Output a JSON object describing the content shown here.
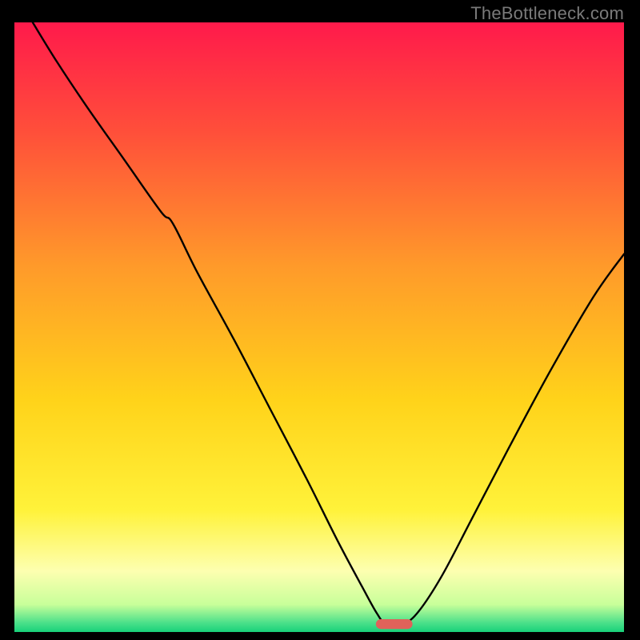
{
  "watermark": "TheBottleneck.com",
  "chart_data": {
    "type": "line",
    "title": "",
    "xlabel": "",
    "ylabel": "",
    "xlim": [
      0,
      100
    ],
    "ylim": [
      0,
      100
    ],
    "grid": false,
    "legend": false,
    "background_gradient": {
      "stops": [
        {
          "offset": 0.0,
          "color": "#ff1a4b"
        },
        {
          "offset": 0.18,
          "color": "#ff4f3a"
        },
        {
          "offset": 0.4,
          "color": "#ff9a2a"
        },
        {
          "offset": 0.62,
          "color": "#ffd31a"
        },
        {
          "offset": 0.8,
          "color": "#fff23a"
        },
        {
          "offset": 0.9,
          "color": "#fdffb0"
        },
        {
          "offset": 0.955,
          "color": "#c8ff9a"
        },
        {
          "offset": 0.985,
          "color": "#4be08a"
        },
        {
          "offset": 1.0,
          "color": "#18d17a"
        }
      ]
    },
    "series": [
      {
        "name": "bottleneck-curve",
        "stroke": "#000000",
        "x": [
          3.0,
          7.0,
          12.0,
          18.0,
          24.0,
          26.0,
          30.0,
          36.0,
          42.0,
          48.0,
          53.0,
          57.0,
          59.5,
          61.0,
          63.5,
          66.0,
          70.0,
          75.0,
          81.0,
          88.0,
          95.0,
          100.0
        ],
        "y": [
          100.0,
          93.5,
          86.0,
          77.5,
          69.0,
          67.0,
          59.0,
          48.0,
          36.5,
          25.0,
          15.0,
          7.5,
          3.0,
          1.3,
          1.3,
          3.0,
          9.0,
          18.5,
          30.0,
          43.0,
          55.0,
          62.0
        ]
      }
    ],
    "marker": {
      "name": "optimal-range",
      "shape": "capsule",
      "x": 62.3,
      "y": 1.3,
      "width": 6.0,
      "height": 1.6,
      "fill": "#e0625a"
    }
  }
}
